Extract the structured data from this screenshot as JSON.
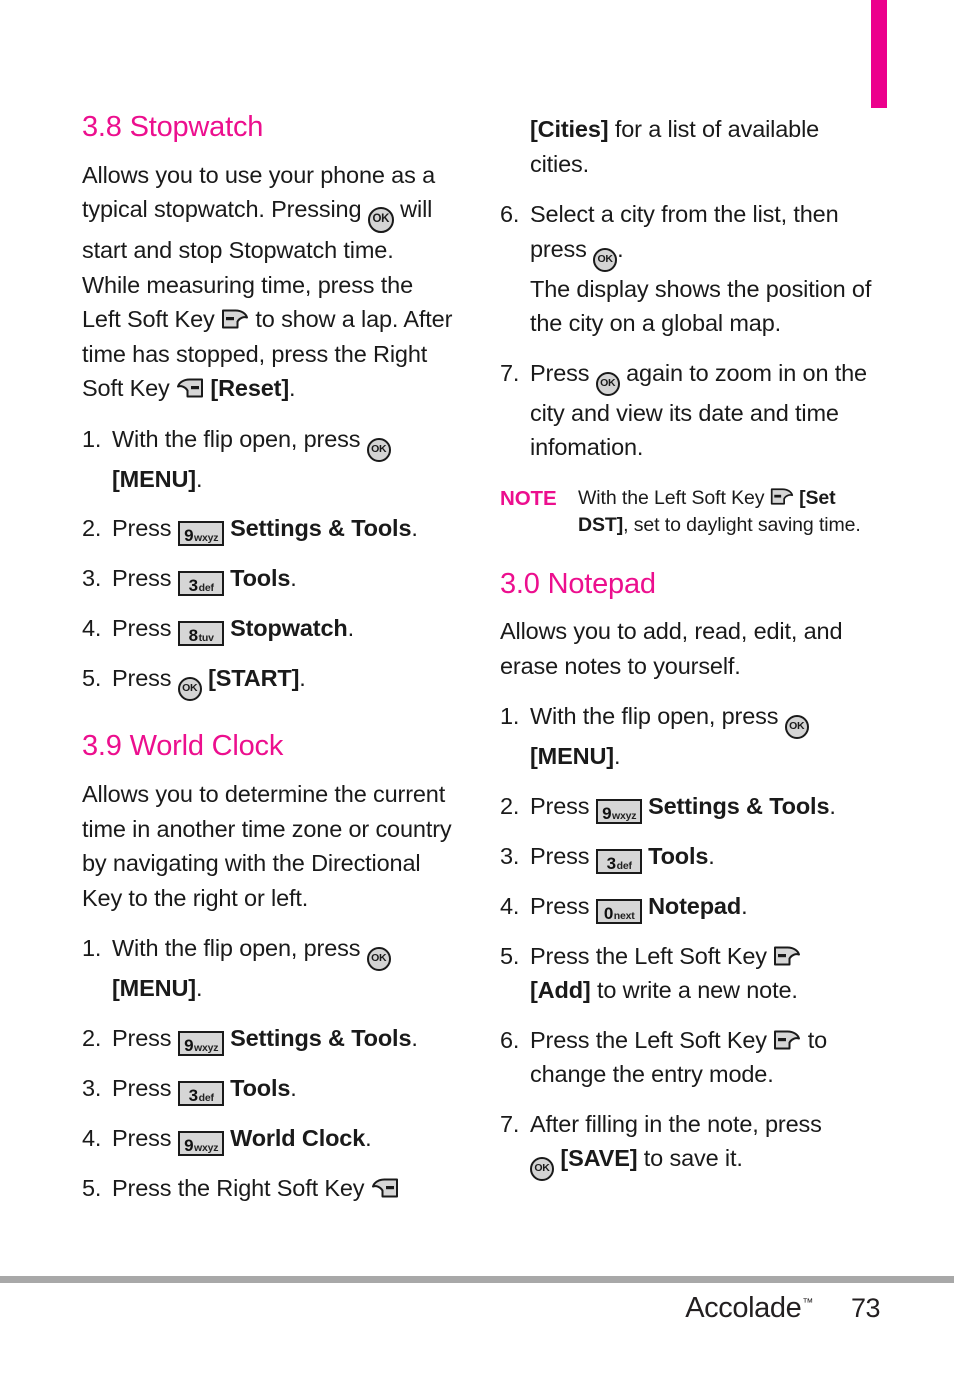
{
  "page": {
    "number": "73",
    "brand": "Accolade",
    "brand_tm": "™",
    "accent_color": "#ec008c",
    "rule_color": "#a8a8a8"
  },
  "icons": {
    "ok": "OK",
    "key9_digit": "9",
    "key9_letters": "wxyz",
    "key3_digit": "3",
    "key3_letters": "def",
    "key8_digit": "8",
    "key8_letters": "tuv",
    "key0_digit": "0",
    "key0_letters": "next"
  },
  "left_column": {
    "stopwatch": {
      "heading": "3.8 Stopwatch",
      "intro_1": "Allows you to use your phone as a typical stopwatch. Pressing",
      "intro_2": "will start and stop Stopwatch time. While measuring time, press the Left Soft Key",
      "intro_3": "to show a lap. After time has stopped, press the Right Soft Key",
      "intro_4": "[Reset]",
      "intro_5": ".",
      "steps": [
        {
          "num": "1.",
          "text_1": "With the flip open, press",
          "text_2": "",
          "bold_cont": "[MENU]",
          "text_3": "."
        },
        {
          "num": "2.",
          "text_1": "Press",
          "key": "9",
          "bold": "Settings & Tools",
          "text_2": "."
        },
        {
          "num": "3.",
          "text_1": "Press",
          "key": "3",
          "bold": "Tools",
          "text_2": "."
        },
        {
          "num": "4.",
          "text_1": "Press",
          "key": "8",
          "bold": "Stopwatch",
          "text_2": "."
        },
        {
          "num": "5.",
          "text_1": "Press",
          "bold": "[START]",
          "text_2": "."
        }
      ]
    },
    "world_clock": {
      "heading": "3.9 World Clock",
      "intro": "Allows you to determine the current time in another time zone or country by navigating with the Directional Key to the right or left.",
      "steps": [
        {
          "num": "1.",
          "text_1": "With the flip open, press",
          "bold_cont": "[MENU]",
          "text_3": "."
        },
        {
          "num": "2.",
          "text_1": "Press",
          "key": "9",
          "bold": "Settings & Tools",
          "text_2": "."
        },
        {
          "num": "3.",
          "text_1": "Press",
          "key": "3",
          "bold": "Tools",
          "text_2": "."
        },
        {
          "num": "4.",
          "text_1": "Press",
          "key": "9",
          "bold": "World Clock",
          "text_2": "."
        },
        {
          "num": "5.",
          "text_1": "Press the Right Soft Key"
        }
      ]
    }
  },
  "right_column": {
    "world_clock_cont": {
      "step5_cont_bold": "[Cities]",
      "step5_cont_text": "for a list of available cities.",
      "steps": [
        {
          "num": "6.",
          "text_1": "Select a city from the list, then press",
          "text_2": ".",
          "cont": "The display shows the position of the city on a global map."
        },
        {
          "num": "7.",
          "text_1": "Press",
          "text_2": "again to zoom in on the city and view its date and time infomation."
        }
      ],
      "note": {
        "label": "NOTE",
        "text_1": "With the Left Soft Key",
        "bold_1": "[Set DST]",
        "text_2": ", set to daylight saving time."
      }
    },
    "notepad": {
      "heading": "3.0 Notepad",
      "intro": "Allows you to add, read, edit, and erase notes to yourself.",
      "steps": [
        {
          "num": "1.",
          "text_1": "With the flip open, press",
          "bold_cont": "[MENU]",
          "text_3": "."
        },
        {
          "num": "2.",
          "text_1": "Press",
          "key": "9",
          "bold": "Settings & Tools",
          "text_2": "."
        },
        {
          "num": "3.",
          "text_1": "Press",
          "key": "3",
          "bold": "Tools",
          "text_2": "."
        },
        {
          "num": "4.",
          "text_1": "Press",
          "key": "0",
          "bold": "Notepad",
          "text_2": "."
        },
        {
          "num": "5.",
          "text_1": "Press the Left Soft Key",
          "bold_cont": "[Add]",
          "text_3": "to write a new note."
        },
        {
          "num": "6.",
          "text_1": "Press the Left Soft Key",
          "text_2": "to change the entry mode."
        },
        {
          "num": "7.",
          "text_1": "After filling in the note, press",
          "bold_cont": "[SAVE]",
          "text_3": "to save it."
        }
      ]
    }
  }
}
